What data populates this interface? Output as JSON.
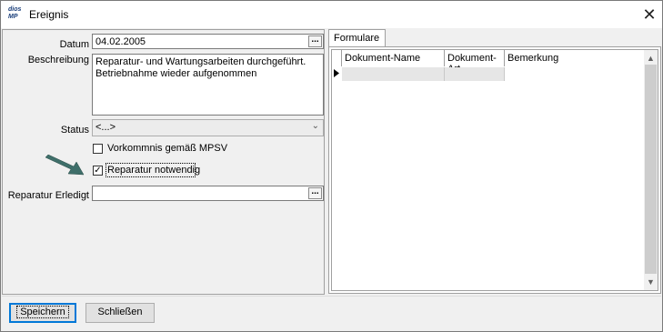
{
  "window": {
    "title": "Ereignis",
    "icon_text_1": "dios",
    "icon_text_2": "MP",
    "close_glyph": "✕"
  },
  "form": {
    "datum_label": "Datum",
    "datum_value": "04.02.2005",
    "beschreibung_label": "Beschreibung",
    "beschreibung_value": "Reparatur- und Wartungsarbeiten durchgeführt.\nBetriebnahme wieder aufgenommen",
    "status_label": "Status",
    "status_value": "<...>",
    "checkbox_mpsv_label": "Vorkommnis gemäß MPSV",
    "checkbox_mpsv_checked": false,
    "checkbox_reparatur_label": "Reparatur notwendig",
    "checkbox_reparatur_checked": true,
    "reparatur_erledigt_label": "Reparatur Erledigt",
    "reparatur_erledigt_value": "",
    "dots_button": "..."
  },
  "tabs": [
    {
      "label": "Formulare",
      "active": true
    }
  ],
  "grid": {
    "columns": [
      "Dokument-Name",
      "Dokument-Art",
      "Bemerkung"
    ],
    "rows": []
  },
  "footer": {
    "save_button": "Speichern",
    "close_button": "Schließen"
  },
  "colors": {
    "arrow": "#3f6f6a",
    "default_button_border": "#0078d7"
  }
}
